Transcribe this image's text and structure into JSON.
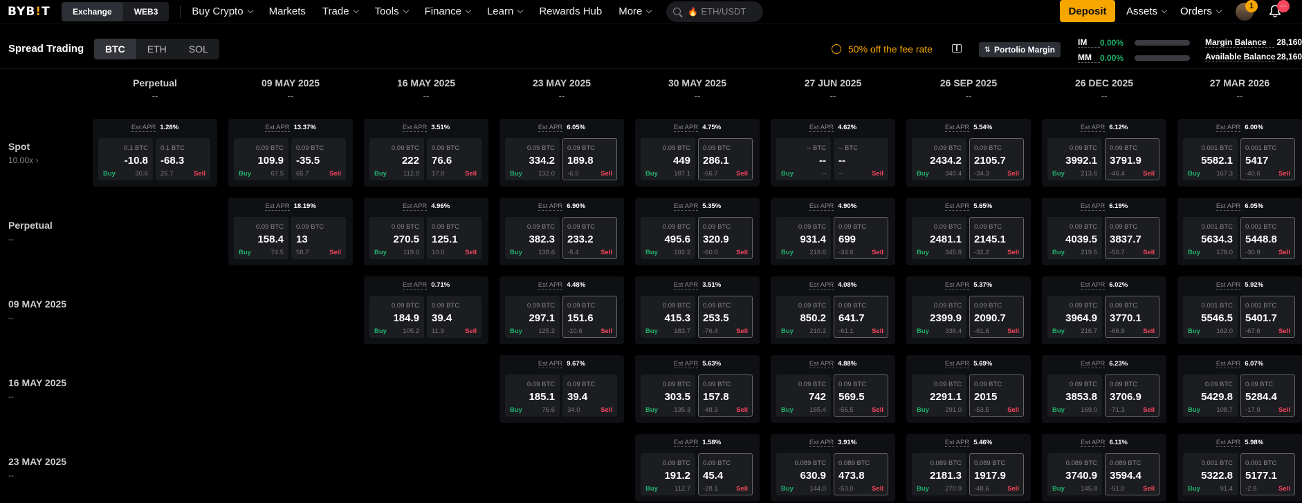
{
  "nav": {
    "logo": "BYB!T",
    "exchange": "Exchange",
    "web3": "WEB3",
    "items": [
      {
        "label": "Buy Crypto",
        "chevron": true
      },
      {
        "label": "Markets",
        "chevron": false
      },
      {
        "label": "Trade",
        "chevron": true
      },
      {
        "label": "Tools",
        "chevron": true
      },
      {
        "label": "Finance",
        "chevron": true
      },
      {
        "label": "Learn",
        "chevron": true
      },
      {
        "label": "Rewards Hub",
        "chevron": false
      },
      {
        "label": "More",
        "chevron": true
      }
    ],
    "search_placeholder": "ETH/USDT",
    "deposit": "Deposit",
    "assets": "Assets",
    "orders": "Orders",
    "avatar_badge": "1",
    "bell_badge": "···",
    "accent": "#f7a600"
  },
  "sub": {
    "title": "Spread Trading",
    "coins": [
      "BTC",
      "ETH",
      "SOL"
    ],
    "active_coin": "BTC",
    "fee": "50% off the fee rate",
    "pm": "Portolio Margin",
    "im_label": "IM",
    "im_value": "0.00%",
    "mm_label": "MM",
    "mm_value": "0.00%",
    "margin_balance_label": "Margin Balance",
    "margin_balance_value": "28,160",
    "available_balance_label": "Available Balance",
    "available_balance_value": "28,160"
  },
  "columns": [
    {
      "date": "Perpetual",
      "sub": "--"
    },
    {
      "date": "09 MAY 2025",
      "sub": "--"
    },
    {
      "date": "16 MAY 2025",
      "sub": "--"
    },
    {
      "date": "23 MAY 2025",
      "sub": "--"
    },
    {
      "date": "30 MAY 2025",
      "sub": "--"
    },
    {
      "date": "27 JUN 2025",
      "sub": "--"
    },
    {
      "date": "26 SEP 2025",
      "sub": "--"
    },
    {
      "date": "26 DEC 2025",
      "sub": "--"
    },
    {
      "date": "27 MAR 2026",
      "sub": "--"
    }
  ],
  "rows": [
    {
      "name": "Spot",
      "sub": "10.00x ›",
      "start": 0,
      "cells": [
        {
          "apr": "1.28%",
          "bs": "0.1 BTC",
          "bp": "-10.8",
          "bv": "30.6",
          "ss": "0.1 BTC",
          "sp": "-68.3",
          "sv": "26.7",
          "hl": false
        },
        {
          "apr": "13.37%",
          "bs": "0.09 BTC",
          "bp": "109.9",
          "bv": "67.5",
          "ss": "0.09 BTC",
          "sp": "-35.5",
          "sv": "65.7",
          "hl": false
        },
        {
          "apr": "3.51%",
          "bs": "0.09 BTC",
          "bp": "222",
          "bv": "112.0",
          "ss": "0.09 BTC",
          "sp": "76.6",
          "sv": "17.0",
          "hl": false
        },
        {
          "apr": "6.05%",
          "bs": "0.09 BTC",
          "bp": "334.2",
          "bv": "132.0",
          "ss": "0.09 BTC",
          "sp": "189.8",
          "sv": "-6.5",
          "hl": true
        },
        {
          "apr": "4.75%",
          "bs": "0.09 BTC",
          "bp": "449",
          "bv": "187.1",
          "ss": "0.09 BTC",
          "sp": "286.1",
          "sv": "-66.7",
          "hl": true
        },
        {
          "apr": "4.62%",
          "bs": "-- BTC",
          "bp": "--",
          "bv": "--",
          "ss": "-- BTC",
          "sp": "--",
          "sv": "--",
          "hl": false
        },
        {
          "apr": "5.54%",
          "bs": "0.09 BTC",
          "bp": "2434.2",
          "bv": "340.4",
          "ss": "0.09 BTC",
          "sp": "2105.7",
          "sv": "-34.3",
          "hl": true
        },
        {
          "apr": "6.12%",
          "bs": "0.09 BTC",
          "bp": "3992.1",
          "bv": "213.6",
          "ss": "0.09 BTC",
          "sp": "3791.9",
          "sv": "-46.4",
          "hl": true
        },
        {
          "apr": "6.00%",
          "bs": "0.001 BTC",
          "bp": "5582.1",
          "bv": "167.3",
          "ss": "0.001 BTC",
          "sp": "5417",
          "sv": "-40.6",
          "hl": true
        }
      ]
    },
    {
      "name": "Perpetual",
      "sub": "--",
      "start": 1,
      "cells": [
        {
          "apr": "18.19%",
          "bs": "0.09 BTC",
          "bp": "158.4",
          "bv": "74.5",
          "ss": "0.09 BTC",
          "sp": "13",
          "sv": "58.7",
          "hl": false
        },
        {
          "apr": "4.96%",
          "bs": "0.09 BTC",
          "bp": "270.5",
          "bv": "119.0",
          "ss": "0.09 BTC",
          "sp": "125.1",
          "sv": "10.0",
          "hl": false
        },
        {
          "apr": "6.90%",
          "bs": "0.09 BTC",
          "bp": "382.3",
          "bv": "138.6",
          "ss": "0.09 BTC",
          "sp": "233.2",
          "sv": "-8.4",
          "hl": true
        },
        {
          "apr": "5.35%",
          "bs": "0.09 BTC",
          "bp": "495.6",
          "bv": "192.2",
          "ss": "0.09 BTC",
          "sp": "320.9",
          "sv": "-60.0",
          "hl": true
        },
        {
          "apr": "4.90%",
          "bs": "0.09 BTC",
          "bp": "931.4",
          "bv": "219.6",
          "ss": "0.09 BTC",
          "sp": "699",
          "sv": "-34.6",
          "hl": true
        },
        {
          "apr": "5.65%",
          "bs": "0.09 BTC",
          "bp": "2481.1",
          "bv": "345.8",
          "ss": "0.09 BTC",
          "sp": "2145.1",
          "sv": "-32.2",
          "hl": true
        },
        {
          "apr": "6.19%",
          "bs": "0.09 BTC",
          "bp": "4039.5",
          "bv": "219.5",
          "ss": "0.09 BTC",
          "sp": "3837.7",
          "sv": "-50.7",
          "hl": true
        },
        {
          "apr": "6.05%",
          "bs": "0.001 BTC",
          "bp": "5634.3",
          "bv": "178.0",
          "ss": "0.001 BTC",
          "sp": "5448.8",
          "sv": "-30.9",
          "hl": true
        }
      ]
    },
    {
      "name": "09 MAY 2025",
      "sub": "--",
      "start": 2,
      "cells": [
        {
          "apr": "0.71%",
          "bs": "0.09 BTC",
          "bp": "184.9",
          "bv": "105.2",
          "ss": "0.09 BTC",
          "sp": "39.4",
          "sv": "11.9",
          "hl": false
        },
        {
          "apr": "4.48%",
          "bs": "0.09 BTC",
          "bp": "297.1",
          "bv": "125.2",
          "ss": "0.09 BTC",
          "sp": "151.6",
          "sv": "-10.6",
          "hl": true
        },
        {
          "apr": "3.51%",
          "bs": "0.09 BTC",
          "bp": "415.3",
          "bv": "183.7",
          "ss": "0.09 BTC",
          "sp": "253.5",
          "sv": "-76.4",
          "hl": true
        },
        {
          "apr": "4.08%",
          "bs": "0.09 BTC",
          "bp": "850.2",
          "bv": "210.2",
          "ss": "0.09 BTC",
          "sp": "641.7",
          "sv": "-61.1",
          "hl": true
        },
        {
          "apr": "5.37%",
          "bs": "0.09 BTC",
          "bp": "2399.9",
          "bv": "336.4",
          "ss": "0.09 BTC",
          "sp": "2090.7",
          "sv": "-61.6",
          "hl": true
        },
        {
          "apr": "6.02%",
          "bs": "0.09 BTC",
          "bp": "3964.9",
          "bv": "216.7",
          "ss": "0.09 BTC",
          "sp": "3770.1",
          "sv": "-66.9",
          "hl": true
        },
        {
          "apr": "5.92%",
          "bs": "0.001 BTC",
          "bp": "5546.5",
          "bv": "162.0",
          "ss": "0.001 BTC",
          "sp": "5401.7",
          "sv": "-67.6",
          "hl": true
        }
      ]
    },
    {
      "name": "16 MAY 2025",
      "sub": "--",
      "start": 3,
      "cells": [
        {
          "apr": "9.67%",
          "bs": "0.09 BTC",
          "bp": "185.1",
          "bv": "76.6",
          "ss": "0.09 BTC",
          "sp": "39.4",
          "sv": "34.0",
          "hl": false
        },
        {
          "apr": "5.63%",
          "bs": "0.09 BTC",
          "bp": "303.5",
          "bv": "135.3",
          "ss": "0.09 BTC",
          "sp": "157.8",
          "sv": "-48.3",
          "hl": true
        },
        {
          "apr": "4.88%",
          "bs": "0.09 BTC",
          "bp": "742",
          "bv": "165.4",
          "ss": "0.09 BTC",
          "sp": "569.5",
          "sv": "-56.5",
          "hl": true
        },
        {
          "apr": "5.69%",
          "bs": "0.09 BTC",
          "bp": "2291.1",
          "bv": "291.0",
          "ss": "0.09 BTC",
          "sp": "2015",
          "sv": "-53.5",
          "hl": true
        },
        {
          "apr": "6.23%",
          "bs": "0.09 BTC",
          "bp": "3853.8",
          "bv": "169.0",
          "ss": "0.09 BTC",
          "sp": "3706.9",
          "sv": "-71.3",
          "hl": true
        },
        {
          "apr": "6.07%",
          "bs": "0.09 BTC",
          "bp": "5429.8",
          "bv": "108.7",
          "ss": "0.09 BTC",
          "sp": "5284.4",
          "sv": "-17.9",
          "hl": true
        }
      ]
    },
    {
      "name": "23 MAY 2025",
      "sub": "--",
      "start": 4,
      "cells": [
        {
          "apr": "1.58%",
          "bs": "0.09 BTC",
          "bp": "191.2",
          "bv": "112.7",
          "ss": "0.09 BTC",
          "sp": "45.4",
          "sv": "-28.1",
          "hl": true
        },
        {
          "apr": "3.91%",
          "bs": "0.089 BTC",
          "bp": "630.9",
          "bv": "144.0",
          "ss": "0.089 BTC",
          "sp": "473.8",
          "sv": "-53.0",
          "hl": true
        },
        {
          "apr": "5.46%",
          "bs": "0.089 BTC",
          "bp": "2181.3",
          "bv": "270.9",
          "ss": "0.089 BTC",
          "sp": "1917.9",
          "sv": "-48.6",
          "hl": true
        },
        {
          "apr": "6.11%",
          "bs": "0.089 BTC",
          "bp": "3740.9",
          "bv": "145.8",
          "ss": "0.089 BTC",
          "sp": "3594.4",
          "sv": "-51.0",
          "hl": true
        },
        {
          "apr": "5.98%",
          "bs": "0.001 BTC",
          "bp": "5322.8",
          "bv": "91.4",
          "ss": "0.001 BTC",
          "sp": "5177.1",
          "sv": "-2.8",
          "hl": true
        }
      ]
    }
  ],
  "labels": {
    "est_apr": "Est APR",
    "buy": "Buy",
    "sell": "Sell"
  }
}
